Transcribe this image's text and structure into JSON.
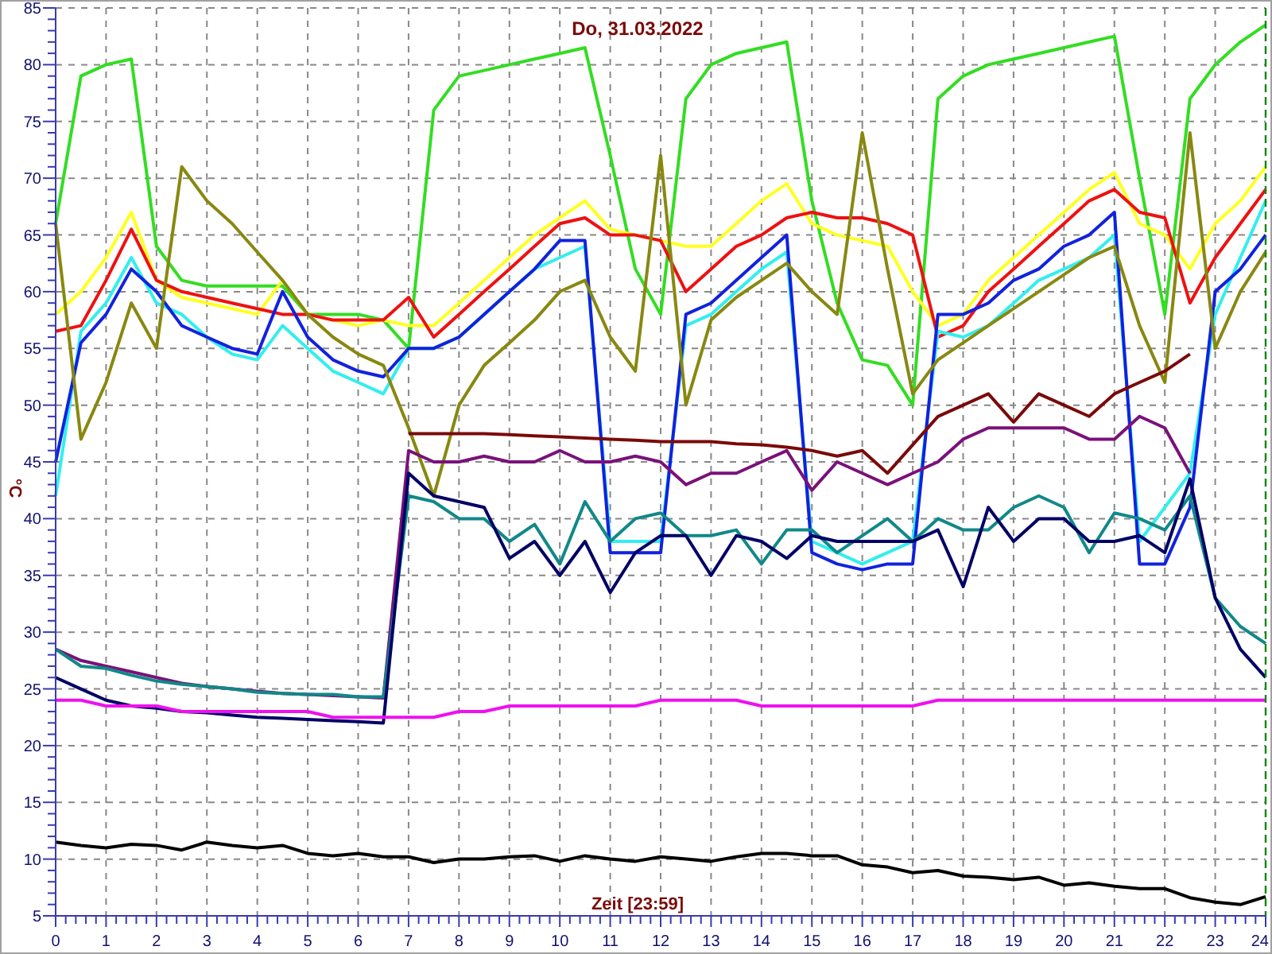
{
  "chart": {
    "chart_data": {
      "type": "line",
      "title": "Do, 31.03.2022",
      "xlabel": "Zeit [23:59]",
      "ylabel": "°C",
      "x": [
        0,
        0.5,
        1,
        1.5,
        2,
        2.5,
        3,
        3.5,
        4,
        4.5,
        5,
        5.5,
        6,
        6.5,
        7,
        7.5,
        8,
        8.5,
        9,
        9.5,
        10,
        10.5,
        11,
        11.5,
        12,
        12.5,
        13,
        13.5,
        14,
        14.5,
        15,
        15.5,
        16,
        16.5,
        17,
        17.5,
        18,
        18.5,
        19,
        19.5,
        20,
        20.5,
        21,
        21.5,
        22,
        22.5,
        23,
        23.5,
        24
      ],
      "xlim": [
        0,
        24
      ],
      "ylim": [
        5,
        85
      ],
      "xticks": [
        0,
        1,
        2,
        3,
        4,
        5,
        6,
        7,
        8,
        9,
        10,
        11,
        12,
        13,
        14,
        15,
        16,
        17,
        18,
        19,
        20,
        21,
        22,
        23,
        24
      ],
      "yticks": [
        5,
        10,
        15,
        20,
        25,
        30,
        35,
        40,
        45,
        50,
        55,
        60,
        65,
        70,
        75,
        80,
        85
      ],
      "series": [
        {
          "color": "#33dd22",
          "values": [
            66,
            79,
            80,
            80.5,
            64,
            61,
            60.5,
            60.5,
            60.5,
            60.5,
            58,
            58,
            58,
            57.5,
            55,
            76,
            79,
            79.5,
            80,
            80.5,
            81,
            81.5,
            72,
            62,
            58,
            77,
            80,
            81,
            81.5,
            82,
            68,
            59,
            54,
            53.5,
            50,
            77,
            79,
            80,
            80.5,
            81,
            81.5,
            82,
            82.5,
            70,
            58,
            77,
            80,
            82,
            83.5
          ]
        },
        {
          "color": "#ffff22",
          "values": [
            58,
            60,
            63,
            67,
            61,
            59.5,
            59,
            58.5,
            58,
            61,
            58,
            57.5,
            57,
            57.5,
            57,
            57,
            59,
            61,
            63,
            65,
            66.5,
            68,
            65.5,
            65,
            64.5,
            64,
            64,
            66,
            68,
            69.5,
            66,
            65,
            64.5,
            64,
            60,
            57,
            58,
            61,
            63,
            65,
            67,
            69,
            70.5,
            66,
            65,
            62,
            66,
            68,
            71
          ]
        },
        {
          "color": "#ee1111",
          "values": [
            56.5,
            57,
            61,
            65.5,
            61,
            60,
            59.5,
            59,
            58.5,
            58,
            58,
            57.5,
            57.5,
            57.5,
            59.5,
            56,
            58,
            60,
            62,
            64,
            66,
            66.5,
            65,
            65,
            64.5,
            60,
            62,
            64,
            65,
            66.5,
            67,
            66.5,
            66.5,
            66,
            65,
            56,
            57,
            60,
            62,
            64,
            66,
            68,
            69,
            67,
            66.5,
            59,
            63,
            66,
            69
          ]
        },
        {
          "color": "#33eeee",
          "values": [
            42,
            56.5,
            59,
            63,
            59,
            58,
            56,
            54.5,
            54,
            57,
            55,
            53,
            52,
            51,
            55,
            55,
            56,
            58,
            60,
            62,
            63,
            64,
            38,
            38,
            38,
            57,
            58,
            60,
            62,
            63.5,
            38,
            37,
            36,
            37,
            38,
            56.5,
            56,
            57,
            59,
            61,
            62,
            63,
            65,
            38,
            41,
            44,
            58,
            63,
            68
          ]
        },
        {
          "color": "#1122dd",
          "values": [
            45,
            55.5,
            58,
            62,
            60,
            57,
            56,
            55,
            54.5,
            60,
            56,
            54,
            53,
            52.5,
            55,
            55,
            56,
            58,
            60,
            62,
            64.5,
            64.5,
            37,
            37,
            37,
            58,
            59,
            61,
            63,
            65,
            37,
            36,
            35.5,
            36,
            36,
            58,
            58,
            59,
            61,
            62,
            64,
            65,
            67,
            36,
            36,
            41,
            60,
            62,
            65
          ]
        },
        {
          "color": "#888811",
          "values": [
            66,
            47,
            52,
            59,
            55,
            71,
            68,
            66,
            63.5,
            61,
            58,
            56,
            54.5,
            53.5,
            48,
            42,
            50,
            53.5,
            55.5,
            57.5,
            60,
            61,
            56,
            53,
            72,
            50,
            57.5,
            59.5,
            61,
            62.5,
            60,
            58,
            74,
            62,
            51,
            54,
            55.5,
            57,
            58.5,
            60,
            61.5,
            63,
            64,
            57,
            52,
            74,
            55,
            60,
            63.5
          ]
        },
        {
          "color": "#7a0a0a",
          "values": [
            null,
            null,
            null,
            null,
            null,
            null,
            null,
            null,
            null,
            null,
            null,
            null,
            null,
            null,
            47.5,
            47.5,
            47.5,
            47.5,
            47.4,
            47.3,
            47.2,
            47.1,
            47,
            46.9,
            46.8,
            46.8,
            46.8,
            46.6,
            46.5,
            46.3,
            46,
            45.5,
            46,
            44,
            46.5,
            49,
            50,
            51,
            48.5,
            51,
            50,
            49,
            51,
            52,
            53,
            54.5,
            null,
            null,
            null
          ]
        },
        {
          "color": "#7a117a",
          "values": [
            28.5,
            27.5,
            27,
            26.5,
            26,
            25.5,
            25.2,
            25,
            24.8,
            24.6,
            24.5,
            24.4,
            24.3,
            24.2,
            46,
            45,
            45,
            45.5,
            45,
            45,
            46,
            45,
            45,
            45.5,
            45,
            43,
            44,
            44,
            45,
            46,
            42.5,
            45,
            44,
            43,
            44,
            45,
            47,
            48,
            48,
            48,
            48,
            47,
            47,
            49,
            48,
            44,
            null,
            null,
            null
          ]
        },
        {
          "color": "#118888",
          "values": [
            28.5,
            27,
            26.8,
            26.2,
            25.7,
            25.4,
            25.2,
            25,
            24.7,
            24.6,
            24.5,
            24.5,
            24.3,
            24.3,
            42,
            41.5,
            40,
            40,
            38,
            39.5,
            36,
            41.5,
            38,
            40,
            40.5,
            38.5,
            38.5,
            39,
            36,
            39,
            39,
            37,
            38.5,
            40,
            38,
            40,
            39,
            39,
            41,
            42,
            41,
            37,
            40.5,
            40,
            39,
            42,
            33,
            30.5,
            29
          ]
        },
        {
          "color": "#000066",
          "values": [
            26,
            25,
            24,
            23.5,
            23.3,
            23,
            22.9,
            22.7,
            22.5,
            22.4,
            22.3,
            22.2,
            22.1,
            22,
            44,
            42,
            41.5,
            41,
            36.5,
            38,
            35,
            38,
            33.5,
            37,
            38.5,
            38.5,
            35,
            38.5,
            38,
            36.5,
            38.5,
            38,
            38,
            38,
            38,
            39,
            34,
            41,
            38,
            40,
            40,
            38,
            38,
            38.5,
            37,
            43.5,
            33,
            28.5,
            26
          ]
        },
        {
          "color": "#ee11ee",
          "values": [
            24,
            24,
            23.5,
            23.5,
            23.5,
            23,
            23,
            23,
            23,
            23,
            23,
            22.5,
            22.5,
            22.5,
            22.5,
            22.5,
            23,
            23,
            23.5,
            23.5,
            23.5,
            23.5,
            23.5,
            23.5,
            24,
            24,
            24,
            24,
            23.5,
            23.5,
            23.5,
            23.5,
            23.5,
            23.5,
            23.5,
            24,
            24,
            24,
            24,
            24,
            24,
            24,
            24,
            24,
            24,
            24,
            24,
            24,
            24
          ]
        },
        {
          "color": "#000000",
          "values": [
            11.5,
            11.2,
            11,
            11.3,
            11.2,
            10.8,
            11.5,
            11.2,
            11,
            11.2,
            10.5,
            10.3,
            10.5,
            10.2,
            10.2,
            9.7,
            10,
            10,
            10.2,
            10.3,
            9.8,
            10.3,
            10,
            9.8,
            10.2,
            10,
            9.8,
            10.2,
            10.5,
            10.5,
            10.3,
            10.3,
            9.5,
            9.3,
            8.8,
            9,
            8.5,
            8.4,
            8.2,
            8.4,
            7.7,
            7.9,
            7.6,
            7.4,
            7.4,
            6.6,
            6.2,
            6,
            6.7
          ]
        }
      ],
      "grid": true
    }
  }
}
